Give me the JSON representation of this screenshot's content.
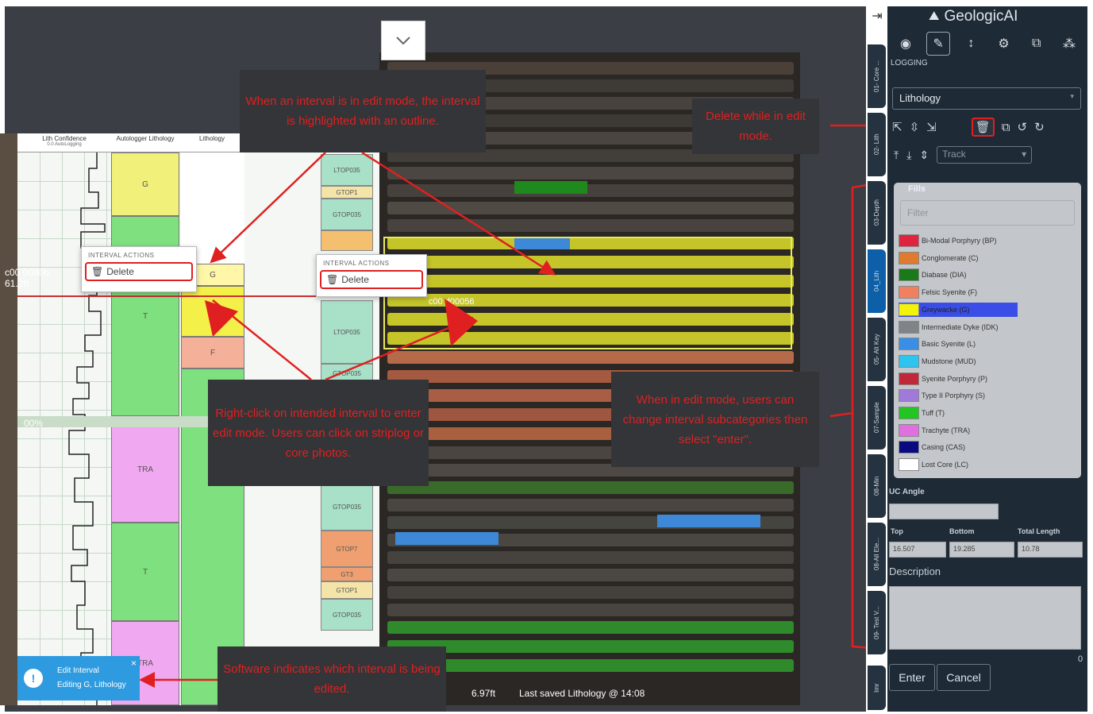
{
  "app": {
    "brand": "GeologicAI"
  },
  "toolbar": {
    "section_label": "LOGGING"
  },
  "logging": {
    "layer_select": "Lithology",
    "track_select": "Track",
    "fills_title": "Fills",
    "filter_placeholder": "Filter",
    "fills": [
      {
        "name": "Bi-Modal Porphyry (BP)",
        "color": "#e0233f"
      },
      {
        "name": "Conglomerate (C)",
        "color": "#e07a2e"
      },
      {
        "name": "Diabase (DIA)",
        "color": "#1a7a1a"
      },
      {
        "name": "Felsic Syenite (F)",
        "color": "#f08060"
      },
      {
        "name": "Greywacke (G)",
        "color": "#f2f20a",
        "selected": true
      },
      {
        "name": "Intermediate Dyke (IDK)",
        "color": "#7f8489"
      },
      {
        "name": "Basic Syenite (L)",
        "color": "#3a8ee6"
      },
      {
        "name": "Mudstone (MUD)",
        "color": "#2ec4f0"
      },
      {
        "name": "Syenite Porphyry (P)",
        "color": "#c0283a"
      },
      {
        "name": "Type II Porphyry (S)",
        "color": "#a07ad8"
      },
      {
        "name": "Tuff (T)",
        "color": "#22c522"
      },
      {
        "name": "Trachyte (TRA)",
        "color": "#e070e0"
      },
      {
        "name": "Casing (CAS)",
        "color": "#0a0a80"
      },
      {
        "name": "Lost Core (LC)",
        "color": "#ffffff"
      }
    ],
    "uc_angle_label": "UC Angle",
    "top_label": "Top",
    "bottom_label": "Bottom",
    "total_length_label": "Total Length",
    "top_value": "16.507",
    "bottom_value": "19.285",
    "total_length_value": "10.78",
    "description_label": "Description",
    "counter": "0",
    "enter_label": "Enter",
    "cancel_label": "Cancel"
  },
  "tabs": [
    "01- Core ...",
    "02- Lith",
    "03-Depth",
    "04_Lith",
    "05- Alt Key",
    "07-Sample",
    "08-Min",
    "08-All Ele...",
    "09- Test V...",
    "Imr"
  ],
  "striplog": {
    "headers": [
      "Lith Confidence",
      "Autologger Lithology",
      "Lithology"
    ],
    "header_sub": "0.0   AutoLogging",
    "blocks": [
      "G",
      "T",
      "TRA",
      "T",
      "TRA"
    ],
    "lith_small": [
      "G",
      "F"
    ],
    "depth_label": "c00 0080b\n61.2ft",
    "pct_label": "00%"
  },
  "subcategories": [
    "LTOP035",
    "GTOP1",
    "GTOP035",
    "LTOP035",
    "GTOP035",
    "GTOP035",
    "GTOP7",
    "GT3",
    "GTOP1",
    "GTOP035"
  ],
  "interval_actions": {
    "title": "INTERVAL ACTIONS",
    "delete_label": "Delete"
  },
  "core_label": "c00 d00056",
  "status_bar": {
    "depth": "6.97ft",
    "saved": "Last saved Lithology @ 14:08"
  },
  "toast": {
    "title": "Edit Interval",
    "subtitle": "Editing G, Lithology",
    "close": "×"
  },
  "annotations": {
    "edit_outline": "When an interval is in edit mode, the interval is highlighted with an outline.",
    "delete_edit": "Delete while in edit mode.",
    "right_click": "Right-click on intended interval to enter edit mode. Users can click on striplog or core photos.",
    "subcategories": "When in edit mode, users can change interval subcategories then select \"enter\".",
    "software_indicates": "Software indicates which interval is being edited."
  },
  "colors": {
    "annotation": "#e02020",
    "panel": "#1e2a36",
    "accent": "#0d5fa8"
  }
}
